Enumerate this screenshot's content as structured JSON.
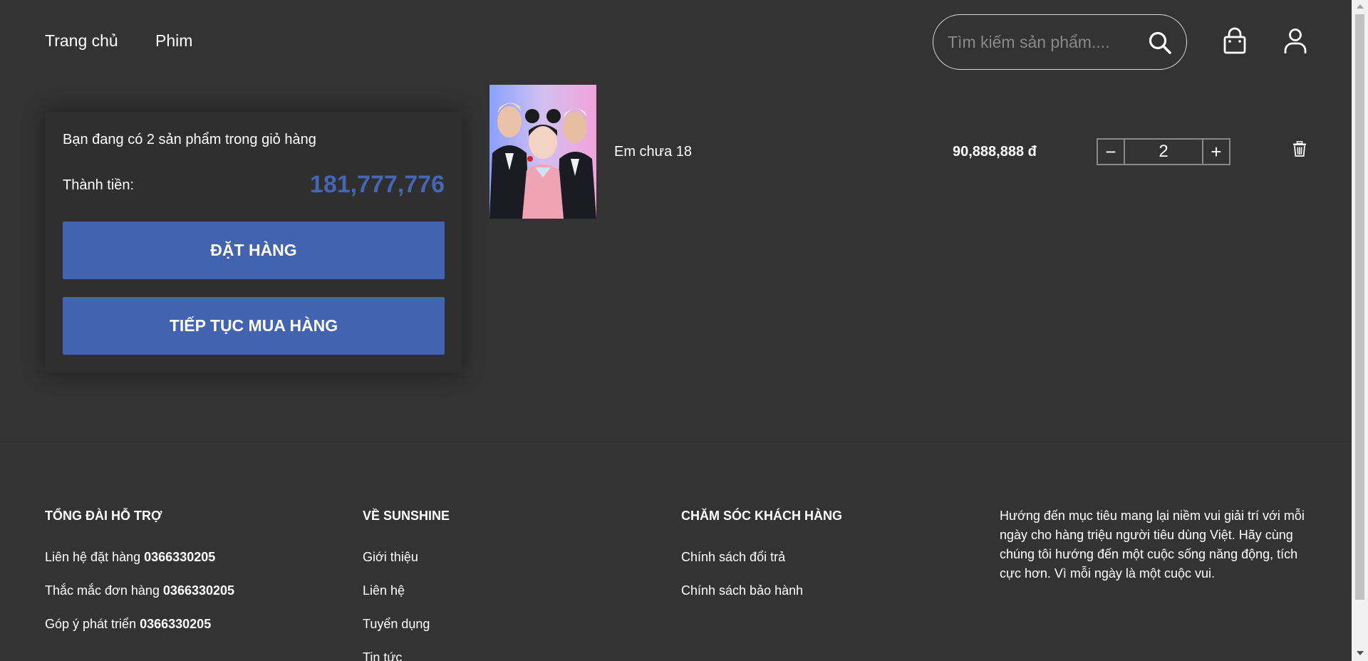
{
  "header": {
    "nav": [
      {
        "label": "Trang chủ"
      },
      {
        "label": "Phim"
      }
    ],
    "search": {
      "placeholder": "Tìm kiếm sản phẩm...."
    },
    "icons": [
      "search-icon",
      "shopping-bag-icon",
      "user-icon"
    ]
  },
  "summary": {
    "count_text": "Bạn đang có 2 sản phẩm trong giỏ hàng",
    "total_label": "Thành tiền:",
    "total_value": "181,777,776",
    "order_button": "ĐẶT HÀNG",
    "continue_button": "TIẾP TỤC MUA HÀNG",
    "accent_color": "#4264b0"
  },
  "cart_item": {
    "name": "Em chưa 18",
    "price": "90,888,888 đ",
    "quantity": "2",
    "minus": "−",
    "plus": "+"
  },
  "footer": {
    "support": {
      "heading": "TỔNG ĐÀI HỖ TRỢ",
      "lines": [
        {
          "label": "Liên hệ đặt hàng",
          "phone": "0366330205"
        },
        {
          "label": "Thắc mắc đơn hàng",
          "phone": "0366330205"
        },
        {
          "label": "Góp ý phát triển",
          "phone": "0366330205"
        }
      ]
    },
    "about": {
      "heading": "VỀ SUNSHINE",
      "links": [
        "Giới thiệu",
        "Liên hệ",
        "Tuyển dụng",
        "Tin tức"
      ]
    },
    "care": {
      "heading": "CHĂM SÓC KHÁCH HÀNG",
      "links": [
        "Chính sách đổi trả",
        "Chính sách bảo hành"
      ]
    },
    "mission": "Hướng đến mục tiêu mang lại niềm vui giải trí với mỗi ngày cho hàng triệu người tiêu dùng Việt. Hãy cùng chúng tôi hướng đến một cuộc sống năng động, tích cực hơn. Vì mỗi ngày là một cuộc vui."
  }
}
